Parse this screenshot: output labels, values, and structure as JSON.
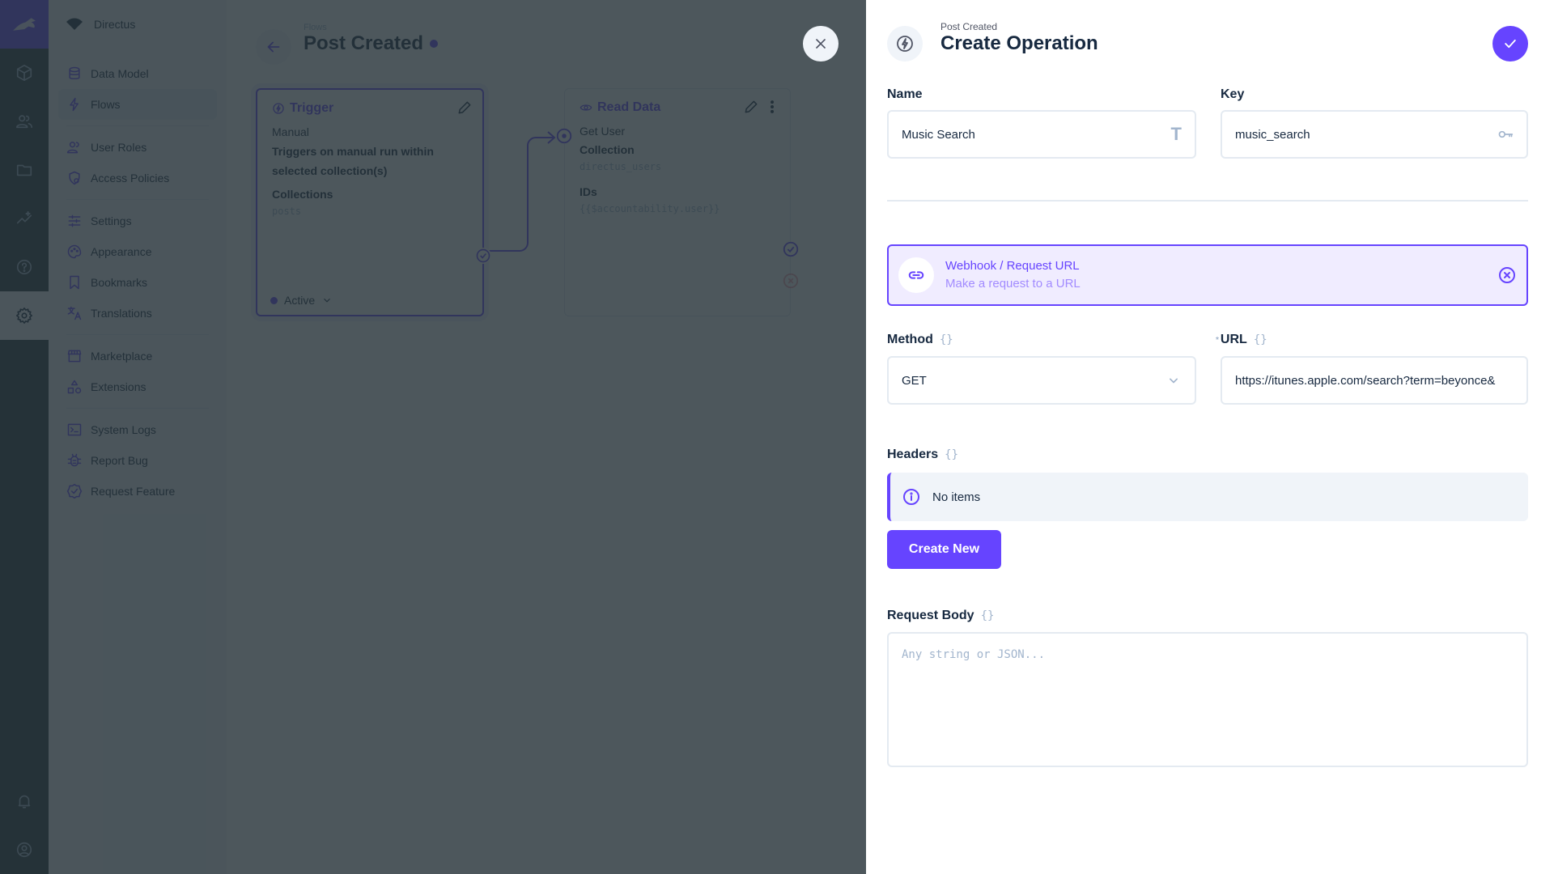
{
  "app": {
    "project_name": "Directus",
    "module_bar": [
      {
        "name": "content",
        "icon": "box-icon"
      },
      {
        "name": "users",
        "icon": "users-icon"
      },
      {
        "name": "files",
        "icon": "folder-icon"
      },
      {
        "name": "insights",
        "icon": "insights-icon"
      },
      {
        "name": "help",
        "icon": "help-icon"
      },
      {
        "name": "settings",
        "icon": "gear-icon",
        "active": true
      }
    ],
    "module_bottom": [
      {
        "name": "notifications",
        "icon": "bell-icon"
      },
      {
        "name": "user-menu",
        "icon": "account-icon"
      }
    ]
  },
  "nav": {
    "groups": [
      [
        {
          "label": "Data Model",
          "icon": "database-icon"
        },
        {
          "label": "Flows",
          "icon": "bolt-icon",
          "active": true
        }
      ],
      [
        {
          "label": "User Roles",
          "icon": "users-icon"
        },
        {
          "label": "Access Policies",
          "icon": "policy-icon"
        }
      ],
      [
        {
          "label": "Settings",
          "icon": "sliders-icon"
        },
        {
          "label": "Appearance",
          "icon": "palette-icon"
        },
        {
          "label": "Bookmarks",
          "icon": "bookmark-icon"
        },
        {
          "label": "Translations",
          "icon": "translate-icon"
        }
      ],
      [
        {
          "label": "Marketplace",
          "icon": "store-icon"
        },
        {
          "label": "Extensions",
          "icon": "shapes-icon"
        }
      ],
      [
        {
          "label": "System Logs",
          "icon": "terminal-icon"
        },
        {
          "label": "Report Bug",
          "icon": "bug-icon"
        },
        {
          "label": "Request Feature",
          "icon": "verified-icon"
        }
      ]
    ]
  },
  "flow_page": {
    "breadcrumb": "Flows",
    "title": "Post Created",
    "trigger_card": {
      "title": "Trigger",
      "type": "Manual",
      "description_line1": "Triggers on manual run within",
      "description_line2": "selected collection(s)",
      "collections_label": "Collections",
      "collections_value": "posts",
      "status": "Active"
    },
    "read_card": {
      "title": "Read Data",
      "name": "Get User",
      "collection_label": "Collection",
      "collection_value": "directus_users",
      "ids_label": "IDs",
      "ids_value": "{{$accountability.user}}"
    }
  },
  "drawer": {
    "breadcrumb": "Post Created",
    "title": "Create Operation",
    "name_field": {
      "label": "Name",
      "value": "Music Search"
    },
    "key_field": {
      "label": "Key",
      "value": "music_search"
    },
    "operation_type": {
      "name": "Webhook / Request URL",
      "description": "Make a request to a URL"
    },
    "method_field": {
      "label": "Method",
      "raw_toggle": "{}",
      "value": "GET"
    },
    "url_field": {
      "label": "URL",
      "required_marker": "*",
      "raw_toggle": "{}",
      "value": "https://itunes.apple.com/search?term=beyonce&"
    },
    "headers_field": {
      "label": "Headers",
      "raw_toggle": "{}",
      "empty_text": "No items",
      "create_label": "Create New"
    },
    "body_field": {
      "label": "Request Body",
      "raw_toggle": "{}",
      "placeholder": "Any string or JSON..."
    }
  },
  "colors": {
    "accent": "#6644ff",
    "module_bar": "#263238",
    "nav_bg": "#f0f4f9",
    "text": "#172940",
    "muted": "#a2b5cd",
    "overlay": "#263238"
  }
}
